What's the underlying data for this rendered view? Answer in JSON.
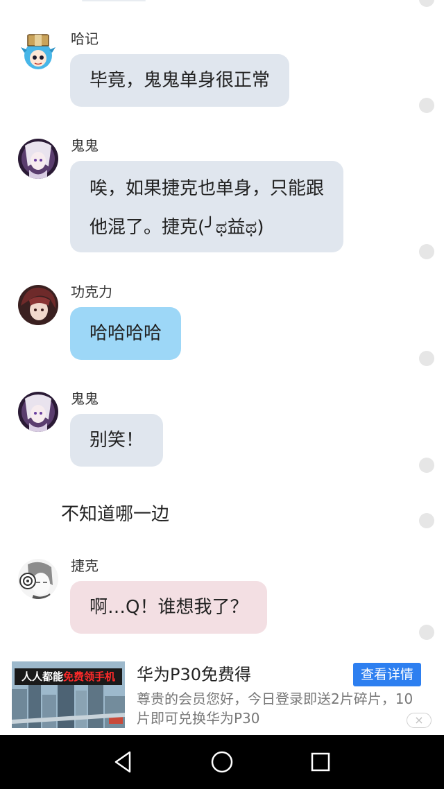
{
  "messages": [
    {
      "sender": "哈记",
      "lines": [
        "毕竟，鬼鬼单身很正常"
      ]
    },
    {
      "sender": "鬼鬼",
      "lines": [
        "唉，如果捷克也单身，只能跟",
        "他混了。捷克(╯ಥ益ಥ)"
      ]
    },
    {
      "sender": "功克力",
      "lines": [
        "哈哈哈哈"
      ]
    },
    {
      "sender": "鬼鬼",
      "lines": [
        "别笑！"
      ]
    },
    {
      "sender": "捷克",
      "lines": [
        "啊…Q！谁想我了？"
      ]
    }
  ],
  "narration": "不知道哪一边",
  "ad": {
    "image_banner_prefix": "人人都能",
    "image_banner_highlight": "免费领手机",
    "title": "华为P30免费得",
    "button": "查看详情",
    "description": "尊贵的会员您好，今日登录即送2片碎片，10片即可兑换华为P30",
    "close": "×"
  },
  "nav": {
    "back": "back-icon",
    "home": "home-icon",
    "recents": "recents-icon"
  },
  "colors": {
    "bubble_gray": "#e0e6ee",
    "bubble_blue": "#9dd7f7",
    "bubble_pink": "#f3dfe3",
    "ad_button": "#2d7ff0"
  }
}
